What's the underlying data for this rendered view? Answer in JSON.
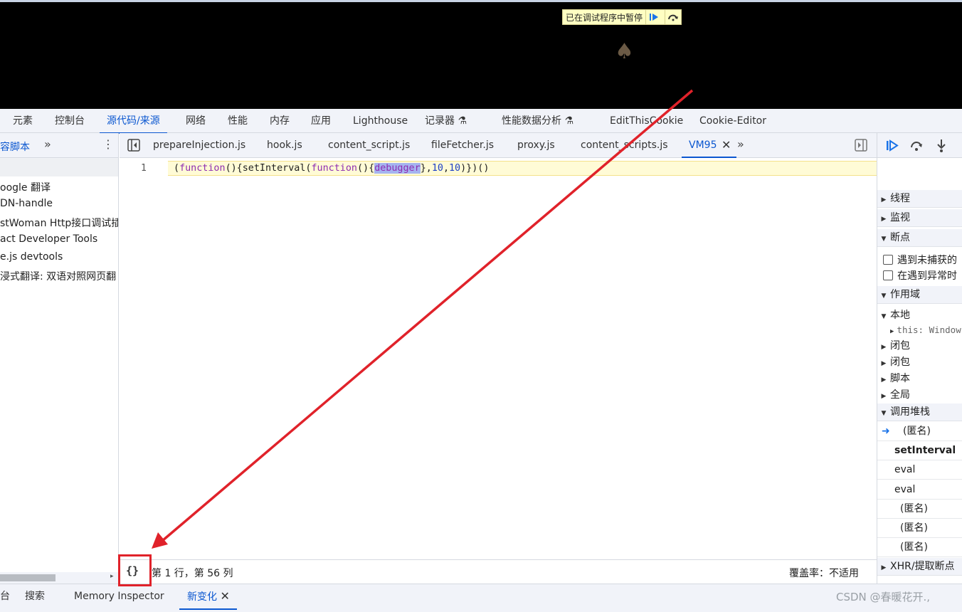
{
  "page_viewport": {
    "paused_banner": "已在调试程序中暂停",
    "spade_glyph": "♠"
  },
  "panel_tabs": [
    "元素",
    "控制台",
    "源代码/来源",
    "网络",
    "性能",
    "内存",
    "应用",
    "Lighthouse",
    "记录器",
    "性能数据分析",
    "EditThisCookie",
    "Cookie-Editor"
  ],
  "active_panel_tab": "源代码/来源",
  "left_pane": {
    "header_label": "容脚本",
    "extensions": [
      "oogle 翻译",
      "DN-handle",
      "stWoman Http接口调试插",
      "act Developer Tools",
      "e.js devtools",
      "浸式翻译: 双语对照网页翻"
    ]
  },
  "file_tabs": [
    "prepareInjection.js",
    "hook.js",
    "content_script.js",
    "fileFetcher.js",
    "proxy.js",
    "content_scripts.js",
    "VM95"
  ],
  "active_file_tab": "VM95",
  "editor": {
    "line_number": "1",
    "code_parts": {
      "open": "(",
      "kw1": "function",
      "mid1": "(){setInterval(",
      "kw2": "function",
      "mid2": "(){",
      "debugger": "debugger",
      "mid3": "},",
      "n1": "10",
      "comma": ",",
      "n2": "10",
      "close": ")})()"
    },
    "format_button": "{}",
    "cursor_position": "第 1 行，第 56 列",
    "coverage": "覆盖率：不适用"
  },
  "right_pane": {
    "sections": {
      "threads": "线程",
      "watch": "监视",
      "breakpoints": "断点",
      "scope": "作用域",
      "call_stack": "调用堆栈",
      "xhr": "XHR/提取断点"
    },
    "breakpoint_options": [
      "遇到未捕获的",
      "在遇到异常时"
    ],
    "scope_items": {
      "local": "本地",
      "this_label": "this: Window",
      "closures": [
        "闭包",
        "闭包"
      ],
      "script": "脚本",
      "global": "全局"
    },
    "call_stack_frames": [
      "(匿名)",
      "setInterval（写",
      "eval",
      "eval",
      "(匿名)",
      "(匿名)",
      "(匿名)"
    ]
  },
  "drawer_tabs": [
    "台",
    "搜索",
    "Memory Inspector",
    "新变化"
  ],
  "active_drawer_tab": "新变化",
  "watermark": "CSDN @春暖花开.,",
  "colors": {
    "accent": "#0b57d0",
    "annotation_red": "#e0222a",
    "paused_line_bg": "#fffbd6",
    "keyword": "#8f2eb0",
    "number": "#1f41c6"
  }
}
